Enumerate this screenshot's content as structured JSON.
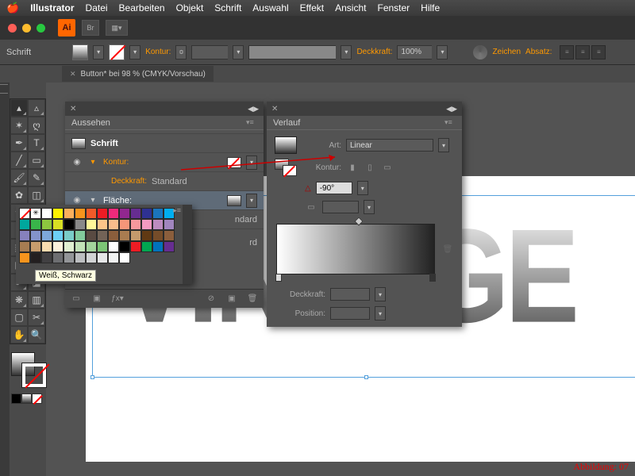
{
  "menubar": {
    "app": "Illustrator",
    "items": [
      "Datei",
      "Bearbeiten",
      "Objekt",
      "Schrift",
      "Auswahl",
      "Effekt",
      "Ansicht",
      "Fenster",
      "Hilfe"
    ]
  },
  "appicon": "Ai",
  "controlbar": {
    "context": "Schrift",
    "kontur_label": "Kontur:",
    "deckkraft_label": "Deckkraft:",
    "deckkraft_value": "100%",
    "zeichen": "Zeichen",
    "absatz": "Absatz:"
  },
  "doc_tab": "Button* bei 98 % (CMYK/Vorschau)",
  "appearance": {
    "title": "Aussehen",
    "schrift": "Schrift",
    "kontur": "Kontur:",
    "deckkraft": "Deckkraft:",
    "standard": "Standard",
    "flaeche": "Fläche:",
    "ndard": "ndard",
    "rd": "rd"
  },
  "gradient": {
    "title": "Verlauf",
    "art": "Art:",
    "linear": "Linear",
    "kontur": "Kontur:",
    "angle": "-90°",
    "deckkraft": "Deckkraft:",
    "position": "Position:"
  },
  "swatch_palette": {
    "rows": [
      [
        "#ffffff",
        "#fef200",
        "#fbaf5d",
        "#f7941d",
        "#f15a29",
        "#ed1c24",
        "#ee2a7b",
        "#92278f",
        "#662d91",
        "#2e3192",
        "#1b75bc",
        "#00aeef",
        "#00a79d",
        "#39b54a",
        "#8dc63f",
        "#d7df23"
      ],
      [
        "#000000",
        "#898989",
        "#fff799",
        "#fdc689",
        "#fabd8c",
        "#f69679",
        "#f5989d",
        "#f49ac1",
        "#bd8cbf",
        "#a186be",
        "#8781bd",
        "#8393ca",
        "#7da7d9",
        "#6dcff6",
        "#7accc8",
        "#82ca9c"
      ],
      [
        "#594a42",
        "#736357",
        "#8b5e3c",
        "#a97c50",
        "#c49a6c",
        "#603913",
        "#754c29",
        "#8b5e3c",
        "#a67c52",
        "#c69c6d",
        "#fadcaf",
        "#fff3db",
        "#e1f0d1",
        "#c2e2b7",
        "#a3d39c",
        "#7cc576"
      ],
      [
        "#ffffff",
        "#000000",
        "#ed1c24",
        "#00a651",
        "#0072bc",
        "#662d91",
        "#f7941d",
        "#231f20",
        "#414042",
        "#6d6e71",
        "#939598",
        "#bcbec0",
        "#d1d3d4",
        "#e6e7e8",
        "#f1f2f2",
        "#ffffff"
      ]
    ],
    "tooltip": "Weiß, Schwarz"
  },
  "canvas_text": "VINTAGE",
  "caption": "Abbildung: 07"
}
